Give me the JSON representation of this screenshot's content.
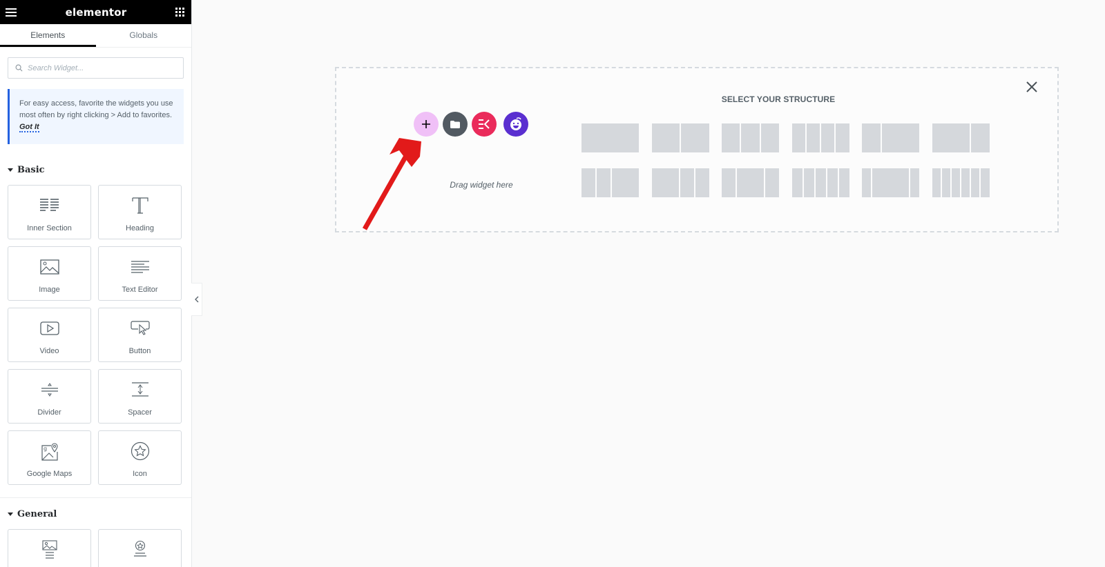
{
  "topbar": {
    "logo": "elementor",
    "menu_icon": "hamburger-icon",
    "apps_icon": "grid-icon"
  },
  "tabs": [
    {
      "label": "Elements",
      "active": true
    },
    {
      "label": "Globals",
      "active": false
    }
  ],
  "search": {
    "placeholder": "Search Widget...",
    "value": ""
  },
  "notice": {
    "text": "For easy access, favorite the widgets you use most often by right clicking > Add to favorites.",
    "link": "Got It",
    "accent": "#2462e0"
  },
  "categories": [
    {
      "title": "Basic",
      "widgets": [
        {
          "label": "Inner Section",
          "icon": "inner-section-icon"
        },
        {
          "label": "Heading",
          "icon": "heading-icon"
        },
        {
          "label": "Image",
          "icon": "image-icon"
        },
        {
          "label": "Text Editor",
          "icon": "text-editor-icon"
        },
        {
          "label": "Video",
          "icon": "video-icon"
        },
        {
          "label": "Button",
          "icon": "button-icon"
        },
        {
          "label": "Divider",
          "icon": "divider-icon"
        },
        {
          "label": "Spacer",
          "icon": "spacer-icon"
        },
        {
          "label": "Google Maps",
          "icon": "google-maps-icon"
        },
        {
          "label": "Icon",
          "icon": "star-icon"
        }
      ]
    },
    {
      "title": "General",
      "widgets": [
        {
          "label": "",
          "icon": "image-box-icon"
        },
        {
          "label": "",
          "icon": "icon-box-icon"
        }
      ]
    }
  ],
  "canvas": {
    "drag_text": "Drag widget here",
    "structure_title": "SELECT YOUR STRUCTURE",
    "buttons": [
      {
        "name": "add-section",
        "icon": "plus-icon",
        "color": "#f0c0f7"
      },
      {
        "name": "add-template",
        "icon": "folder-icon",
        "color": "#525a62"
      },
      {
        "name": "envato-kit",
        "icon": "ek-icon",
        "color": "#ea2b5b"
      },
      {
        "name": "ai-assistant",
        "icon": "smiley-icon",
        "color": "#5a2fd0"
      }
    ],
    "presets_row1": [
      [
        1
      ],
      [
        1,
        1
      ],
      [
        1,
        1,
        1
      ],
      [
        1,
        1,
        1,
        1
      ],
      [
        1,
        2
      ],
      [
        2,
        1
      ]
    ],
    "presets_row2": [
      [
        1,
        1,
        2
      ],
      [
        2,
        1,
        1
      ],
      [
        1,
        2,
        1
      ],
      [
        1,
        1,
        1,
        1,
        1
      ],
      [
        1,
        4,
        1
      ],
      [
        1,
        1,
        1,
        1,
        1,
        1
      ]
    ]
  },
  "annotation": {
    "color": "#e21a1a",
    "points_to": "add-section"
  }
}
